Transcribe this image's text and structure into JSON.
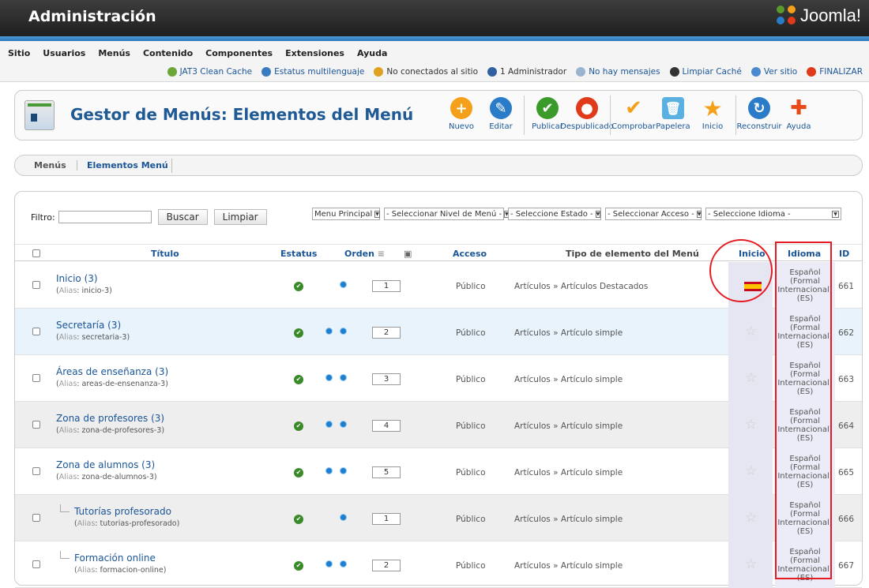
{
  "header": {
    "title": "Administración",
    "brand": "Joomla!"
  },
  "top_menu": [
    "Sitio",
    "Usuarios",
    "Menús",
    "Contenido",
    "Componentes",
    "Extensiones",
    "Ayuda"
  ],
  "status_bar": [
    {
      "label": "JAT3 Clean Cache",
      "icon": "jat3-icon",
      "color": "#6aa63a"
    },
    {
      "label": "Estatus multilenguaje",
      "icon": "globe-icon",
      "color": "#3a7ac0"
    },
    {
      "label": "No conectados al sitio",
      "icon": "users-icon",
      "color": "#e0a020"
    },
    {
      "label": "1 Administrador",
      "icon": "admin-icon",
      "color": "#3060a0"
    },
    {
      "label": "No hay mensajes",
      "icon": "message-icon",
      "color": "#9ab4d0"
    },
    {
      "label": "Limpiar Caché",
      "icon": "joomla-icon",
      "color": "#333"
    },
    {
      "label": "Ver sitio",
      "icon": "monitor-icon",
      "color": "#4a8ad0"
    },
    {
      "label": "FINALIZAR",
      "icon": "logout-icon",
      "color": "#e03a1a"
    }
  ],
  "toolbar": {
    "title": "Gestor de Menús: Elementos del Menú",
    "buttons": [
      {
        "label": "Nuevo",
        "icon": "plus-icon",
        "color": "#f5a01a",
        "glyph": "+"
      },
      {
        "label": "Editar",
        "icon": "pencil-icon",
        "color": "#2a7cc8",
        "glyph": "✎"
      },
      {
        "label": "Publicar",
        "icon": "check-icon",
        "color": "#3a9a2a",
        "glyph": "✔"
      },
      {
        "label": "Despublicado",
        "icon": "unpublish-icon",
        "color": "#e03a1a",
        "glyph": "●"
      },
      {
        "label": "Comprobar",
        "icon": "checkin-icon",
        "color": "#f5a01a",
        "glyph": "✔"
      },
      {
        "label": "Papelera",
        "icon": "trash-icon",
        "color": "#5ab0e0",
        "glyph": "🗑"
      },
      {
        "label": "Inicio",
        "icon": "star-icon",
        "color": "#f5a01a",
        "glyph": "★"
      },
      {
        "label": "Reconstruir",
        "icon": "refresh-icon",
        "color": "#2a7cc8",
        "glyph": "↻"
      },
      {
        "label": "Ayuda",
        "icon": "help-icon",
        "color": "#e84a1a",
        "glyph": "✚"
      }
    ]
  },
  "tabs": [
    "Menús",
    "Elementos Menú"
  ],
  "filter": {
    "label": "Filtro:",
    "value": "",
    "search": "Buscar",
    "clear": "Limpiar"
  },
  "selects": [
    "Menu Principal",
    "- Seleccionar Nivel de Menú -",
    "- Seleccione Estado -",
    "- Seleccionar Acceso -",
    "- Seleccione Idioma -"
  ],
  "columns": {
    "titulo": "Título",
    "estatus": "Estatus",
    "orden": "Orden",
    "acceso": "Acceso",
    "tipo": "Tipo de elemento del Menú",
    "inicio": "Inicio",
    "idioma": "Idioma",
    "id": "ID"
  },
  "alias_label": "Alias",
  "rows": [
    {
      "title": "Inicio (3)",
      "alias": "inicio-3",
      "order": "1",
      "access": "Público",
      "type": "Artículos » Artículos Destacados",
      "home": true,
      "lang": "Español (Formal Internacional) (ES)",
      "id": "661",
      "up": false,
      "down": true,
      "child": false
    },
    {
      "title": "Secretaría (3)",
      "alias": "secretaria-3",
      "order": "2",
      "access": "Público",
      "type": "Artículos » Artículo simple",
      "home": false,
      "lang": "Español (Formal Internacional) (ES)",
      "id": "662",
      "up": true,
      "down": true,
      "child": false
    },
    {
      "title": "Áreas de enseñanza (3)",
      "alias": "areas-de-ensenanza-3",
      "order": "3",
      "access": "Público",
      "type": "Artículos » Artículo simple",
      "home": false,
      "lang": "Español (Formal Internacional) (ES)",
      "id": "663",
      "up": true,
      "down": true,
      "child": false
    },
    {
      "title": "Zona de profesores (3)",
      "alias": "zona-de-profesores-3",
      "order": "4",
      "access": "Público",
      "type": "Artículos » Artículo simple",
      "home": false,
      "lang": "Español (Formal Internacional) (ES)",
      "id": "664",
      "up": true,
      "down": true,
      "child": false
    },
    {
      "title": "Zona de alumnos (3)",
      "alias": "zona-de-alumnos-3",
      "order": "5",
      "access": "Público",
      "type": "Artículos » Artículo simple",
      "home": false,
      "lang": "Español (Formal Internacional) (ES)",
      "id": "665",
      "up": true,
      "down": true,
      "child": false
    },
    {
      "title": "Tutorías profesorado",
      "alias": "tutorias-profesorado",
      "order": "1",
      "access": "Público",
      "type": "Artículos » Artículo simple",
      "home": false,
      "lang": "Español (Formal Internacional) (ES)",
      "id": "666",
      "up": false,
      "down": true,
      "child": true
    },
    {
      "title": "Formación online",
      "alias": "formacion-online",
      "order": "2",
      "access": "Público",
      "type": "Artículos » Artículo simple",
      "home": false,
      "lang": "Español (Formal Internacional) (ES)",
      "id": "667",
      "up": true,
      "down": true,
      "child": true
    }
  ]
}
